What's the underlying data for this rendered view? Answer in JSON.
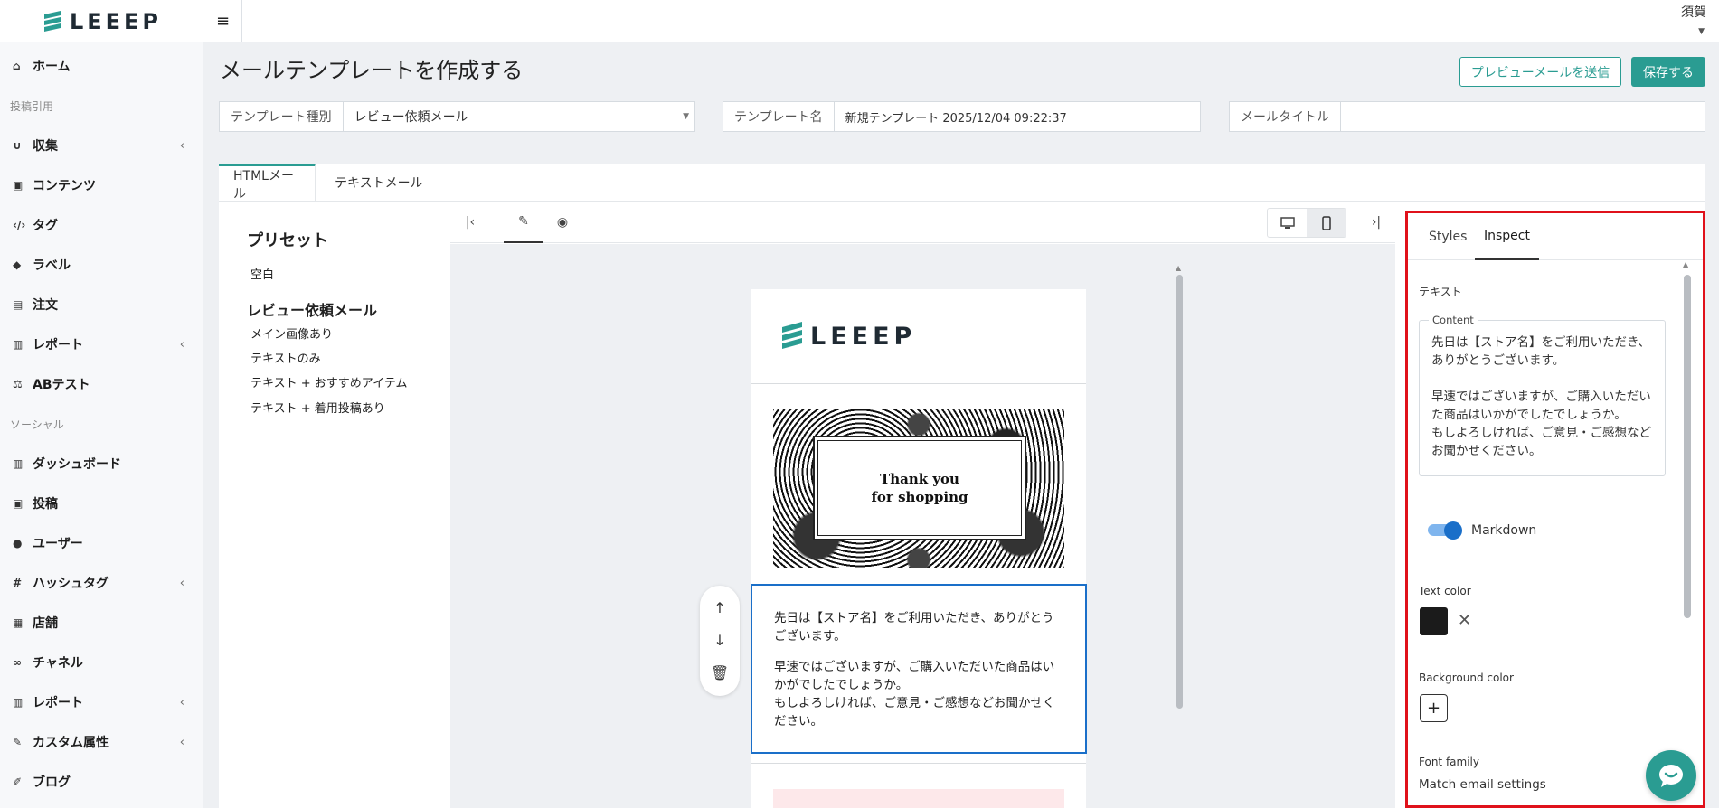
{
  "app": {
    "logo": "LEEEP",
    "user": "須賀"
  },
  "sidebar": {
    "items": [
      {
        "label": "ホーム"
      },
      {
        "section": "投稿引用"
      },
      {
        "label": "収集",
        "has_chevron": true
      },
      {
        "label": "コンテンツ"
      },
      {
        "label": "タグ"
      },
      {
        "label": "ラベル"
      },
      {
        "label": "注文"
      },
      {
        "label": "レポート",
        "has_chevron": true
      },
      {
        "label": "ABテスト"
      },
      {
        "section": "ソーシャル"
      },
      {
        "label": "ダッシュボード"
      },
      {
        "label": "投稿"
      },
      {
        "label": "ユーザー"
      },
      {
        "label": "ハッシュタグ",
        "has_chevron": true
      },
      {
        "label": "店舗"
      },
      {
        "label": "チャネル"
      },
      {
        "label": "レポート",
        "has_chevron": true
      },
      {
        "label": "カスタム属性",
        "has_chevron": true
      },
      {
        "label": "ブログ"
      }
    ]
  },
  "header": {
    "title": "メールテンプレートを作成する",
    "preview_btn": "プレビューメールを送信",
    "save_btn": "保存する"
  },
  "fields": {
    "type_label": "テンプレート種別",
    "type_value": "レビュー依頼メール",
    "name_label": "テンプレート名",
    "name_value": "新規テンプレート 2025/12/04 09:22:37",
    "subject_label": "メールタイトル",
    "subject_value": ""
  },
  "tabs": {
    "html": "HTMLメール",
    "text": "テキストメール"
  },
  "presets": {
    "title": "プリセット",
    "blank": "空白",
    "group": "レビュー依頼メール",
    "items": [
      "メイン画像あり",
      "テキストのみ",
      "テキスト + おすすめアイテム",
      "テキスト + 着用投稿あり"
    ]
  },
  "email": {
    "logo": "LEEEP",
    "hero_line1": "Thank you",
    "hero_line2": "for shopping",
    "para1": "先日は【ストア名】をご利用いただき、ありがとうございます。",
    "para2": "早速ではございますが、ご購入いただいた商品はいかがでしたでしょうか。\nもしよろしければ、ご意見・ご感想などお聞かせください。"
  },
  "inspect": {
    "tab_styles": "Styles",
    "tab_inspect": "Inspect",
    "section": "テキスト",
    "content_legend": "Content",
    "content_text": "先日は【ストア名】をご利用いただき、ありがとうございます。\n\n早速ではございますが、ご購入いただいた商品はいかがでしたでしょうか。\nもしよろしければ、ご意見・ご感想などお聞かせください。",
    "markdown_label": "Markdown",
    "markdown_on": true,
    "text_color_label": "Text color",
    "text_color": "#1b1b1b",
    "bg_color_label": "Background color",
    "font_family_label": "Font family",
    "font_family_value": "Match email settings"
  },
  "colors": {
    "accent": "#2a9c92",
    "selection": "#1a6fc9",
    "highlight": "#e0111b"
  }
}
